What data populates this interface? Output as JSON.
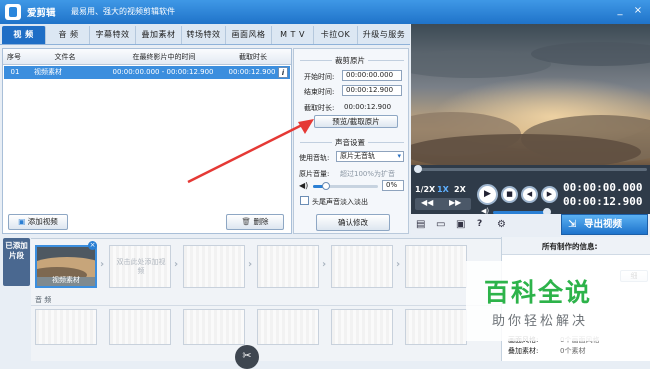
{
  "app": {
    "name": "爱剪辑",
    "slogan": "最易用、强大的视频剪辑软件"
  },
  "window_buttons": [
    "_",
    "×"
  ],
  "tabs": [
    "视 频",
    "音 频",
    "字幕特效",
    "叠加素材",
    "转场特效",
    "画面风格",
    "M T V",
    "卡拉OK",
    "升级与服务"
  ],
  "clip_table": {
    "headers": [
      "序号",
      "文件名",
      "在最终影片中的时间",
      "截取时长"
    ],
    "rows": [
      {
        "index": "01",
        "name": "视频素材",
        "time": "00:00:00.000 - 00:00:12.900",
        "duration": "00:00:12.900"
      }
    ]
  },
  "buttons": {
    "add_video": "添加视频",
    "delete": "删除",
    "preview": "预览/截取原片",
    "confirm": "确认修改",
    "export": "导出视频"
  },
  "clip_panel": {
    "title": "裁剪原片",
    "start_label": "开始时间:",
    "start_value": "00:00:00.000",
    "end_label": "结束时间:",
    "end_value": "00:00:12.900",
    "duration_label": "截取时长:",
    "duration_value": "00:00:12.900"
  },
  "audio_panel": {
    "title": "声音设置",
    "track_label": "使用音轨:",
    "track_value": "原片无音轨",
    "volume_label": "原片音量:",
    "volume_hint": "超过100%为扩音",
    "volume_value": "0%",
    "volume_level": 0.2,
    "fade_label": "头尾声音淡入淡出"
  },
  "player": {
    "speeds": [
      "1/2X",
      "1X",
      "2X"
    ],
    "active_speed": "1X",
    "current_time": "00:00:00.000",
    "total_time": "00:00:12.900",
    "progress": 0
  },
  "timeline": {
    "side_label": "已添加片段",
    "clip_label": "视频素材",
    "drop_hint": "双击此处添加视频",
    "audio_label": "音 频"
  },
  "info_panel": {
    "title": "所有制作的信息:",
    "partial_button": "细",
    "rows": [
      {
        "label": "画面风格:",
        "value": "0个画面风格"
      },
      {
        "label": "叠加素材:",
        "value": "0个素材"
      }
    ]
  },
  "watermark": {
    "title": "百科全说",
    "subtitle": "助你轻松解决"
  },
  "colors": {
    "titlebar": "#2a86dc",
    "accent": "#1f6ec6",
    "arrow": "#e53935",
    "watermark_green": "#2db34a"
  }
}
